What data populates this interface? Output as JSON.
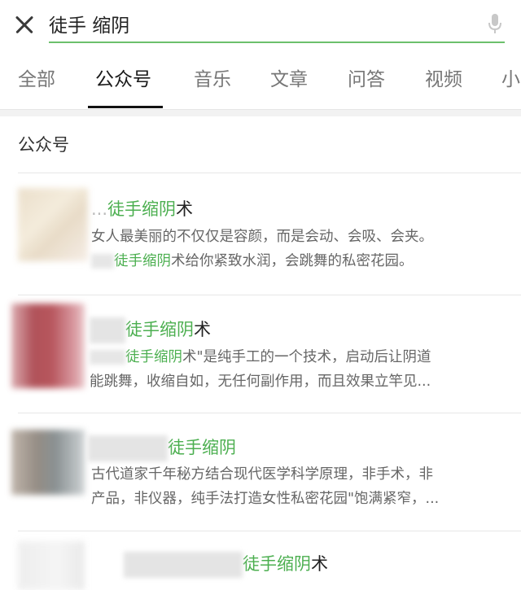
{
  "search": {
    "query": "徒手 缩阴"
  },
  "tabs": [
    {
      "label": "全部"
    },
    {
      "label": "公众号"
    },
    {
      "label": "音乐"
    },
    {
      "label": "文章"
    },
    {
      "label": "问答"
    },
    {
      "label": "视频"
    },
    {
      "label": "小"
    }
  ],
  "active_tab": "公众号",
  "section": {
    "title": "公众号"
  },
  "results": [
    {
      "name_prefix": "...",
      "name_highlight": "徒手缩阴",
      "name_rest": "术",
      "desc_line1": "女人最美丽的不仅仅是容颜，而是会动、会吸、会夹。",
      "desc_line2_highlight": "徒手缩阴",
      "desc_line2_rest": "术给你紧致水润，会跳舞的私密花园。"
    },
    {
      "name_highlight": "徒手缩阴",
      "name_rest": "术",
      "desc_line1_highlight": "徒手缩阴",
      "desc_line1_rest": "术\"是纯手工的一个技术，启动后让阴道",
      "desc_line2": "能跳舞，收缩自如，无任何副作用，而且效果立竿见..."
    },
    {
      "name_highlight": "徒手缩阴",
      "name_rest": "",
      "desc_line1": "古代道家千年秘方结合现代医学科学原理，非手术，非",
      "desc_line2": "产品，非仪器，纯手法打造女性私密花园\"饱满紧窄，..."
    },
    {
      "name_highlight": "徒手缩阴",
      "name_rest": "术"
    }
  ],
  "colors": {
    "highlight": "#4caf50",
    "search_underline": "#6cc06c"
  }
}
